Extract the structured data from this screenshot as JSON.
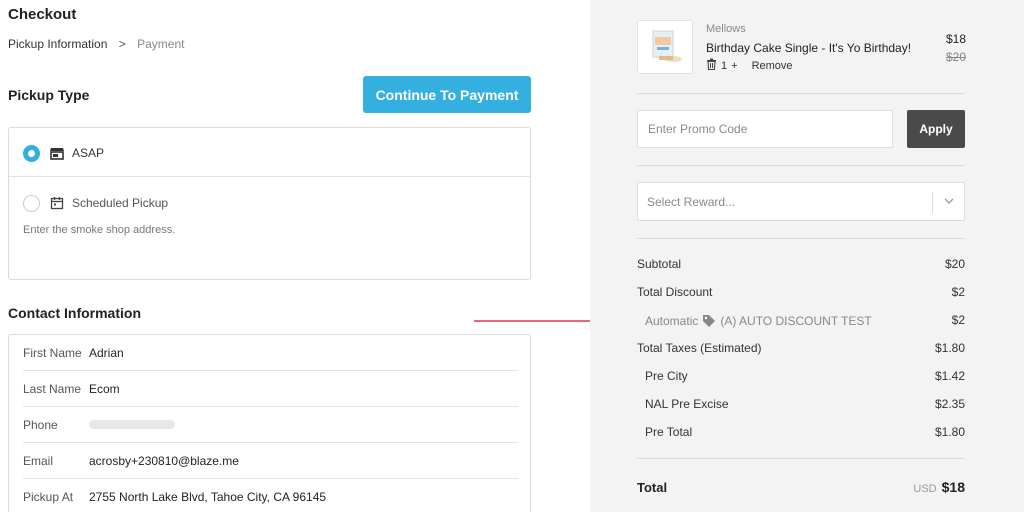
{
  "header": {
    "title": "Checkout",
    "breadcrumb": {
      "step1": "Pickup Information",
      "separator": ">",
      "step2": "Payment"
    }
  },
  "pickup": {
    "title": "Pickup Type",
    "continue_label": "Continue To Payment",
    "options": [
      {
        "label": "ASAP",
        "selected": true,
        "icon": "store-icon"
      },
      {
        "label": "Scheduled Pickup",
        "selected": false,
        "icon": "calendar-icon"
      }
    ],
    "hint": "Enter the smoke shop address."
  },
  "contact": {
    "title": "Contact Information",
    "rows": [
      {
        "label": "First Name",
        "value": "Adrian"
      },
      {
        "label": "Last Name",
        "value": "Ecom"
      },
      {
        "label": "Phone",
        "value": ""
      },
      {
        "label": "Email",
        "value": "acrosby+230810@blaze.me"
      },
      {
        "label": "Pickup At",
        "value": "2755 North Lake Blvd, Tahoe City, CA 96145"
      }
    ]
  },
  "cart": {
    "item": {
      "brand": "Mellows",
      "name": "Birthday Cake Single - It's Yo Birthday!",
      "qty": "1",
      "plus": "+",
      "remove_label": "Remove",
      "price": "$18",
      "original_price": "$20"
    }
  },
  "promo": {
    "placeholder": "Enter Promo Code",
    "apply_label": "Apply"
  },
  "reward": {
    "placeholder": "Select Reward..."
  },
  "summary": {
    "subtotal": {
      "label": "Subtotal",
      "value": "$20"
    },
    "total_discount": {
      "label": "Total Discount",
      "value": "$2"
    },
    "automatic": {
      "label": "Automatic",
      "detail": "(A) AUTO DISCOUNT TEST",
      "value": "$2"
    },
    "taxes": {
      "label": "Total Taxes (Estimated)",
      "value": "$1.80"
    },
    "tax_lines": [
      {
        "label": "Pre City",
        "value": "$1.42"
      },
      {
        "label": "NAL Pre Excise",
        "value": "$2.35"
      },
      {
        "label": "Pre Total",
        "value": "$1.80"
      }
    ],
    "total": {
      "label": "Total",
      "currency": "USD",
      "value": "$18"
    }
  },
  "colors": {
    "accent": "#33b0e0",
    "apply_bg": "#4a4a4a",
    "arrow": "#d9364a"
  }
}
